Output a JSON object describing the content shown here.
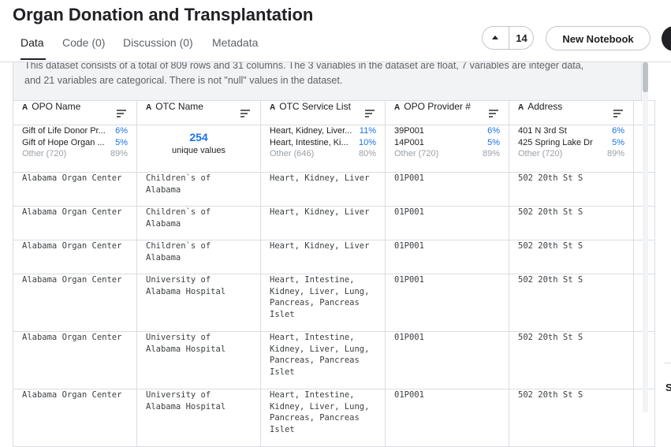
{
  "page": {
    "title": "Organ Donation and Transplantation",
    "tabs": [
      {
        "label": "Data"
      },
      {
        "label": "Code (0)"
      },
      {
        "label": "Discussion (0)"
      },
      {
        "label": "Metadata"
      }
    ],
    "vote_count": "14",
    "new_notebook_label": "New Notebook",
    "side_letter": "S"
  },
  "description": {
    "line1": "This dataset consists of a total of 809 rows and 31 columns. The 3 variables in the dataset are float, 7 variables are integer data,",
    "line2": "and 21 variables are categorical. There is not \"null\" values in the dataset."
  },
  "columns": [
    {
      "type_icon": "A",
      "label": "OPO Name"
    },
    {
      "type_icon": "A",
      "label": "OTC Name"
    },
    {
      "type_icon": "A",
      "label": "OTC Service List"
    },
    {
      "type_icon": "A",
      "label": "OPO Provider #"
    },
    {
      "type_icon": "A",
      "label": "Address"
    }
  ],
  "summary": {
    "opo_name": [
      {
        "k": "Gift of Life Donor Pr...",
        "p": "6%"
      },
      {
        "k": "Gift of Hope Organ ...",
        "p": "5%"
      },
      {
        "k": "Other (720)",
        "p": "89%"
      }
    ],
    "otc_name": {
      "n": "254",
      "l": "unique values"
    },
    "otc_service_list": [
      {
        "k": "Heart, Kidney, Liver...",
        "p": "11%"
      },
      {
        "k": "Heart, Intestine, Ki...",
        "p": "10%"
      },
      {
        "k": "Other (646)",
        "p": "80%"
      }
    ],
    "opo_provider": [
      {
        "k": "39P001",
        "p": "6%"
      },
      {
        "k": "14P001",
        "p": "5%"
      },
      {
        "k": "Other (720)",
        "p": "89%"
      }
    ],
    "address": [
      {
        "k": "401 N 3rd St",
        "p": "6%"
      },
      {
        "k": "425 Spring Lake Dr",
        "p": "5%"
      },
      {
        "k": "Other (720)",
        "p": "89%"
      }
    ]
  },
  "rows": [
    {
      "opo": "Alabama Organ Center",
      "otc": "Children`s of\nAlabama",
      "svc": "Heart, Kidney, Liver",
      "prov": "01P001",
      "addr": "502 20th St S"
    },
    {
      "opo": "Alabama Organ Center",
      "otc": "Children`s of\nAlabama",
      "svc": "Heart, Kidney, Liver",
      "prov": "01P001",
      "addr": "502 20th St S"
    },
    {
      "opo": "Alabama Organ Center",
      "otc": "Children`s of\nAlabama",
      "svc": "Heart, Kidney, Liver",
      "prov": "01P001",
      "addr": "502 20th St S"
    },
    {
      "opo": "Alabama Organ Center",
      "otc": "University of\nAlabama Hospital",
      "svc": "Heart, Intestine,\nKidney, Liver, Lung,\nPancreas, Pancreas\nIslet",
      "prov": "01P001",
      "addr": "502 20th St S"
    },
    {
      "opo": "Alabama Organ Center",
      "otc": "University of\nAlabama Hospital",
      "svc": "Heart, Intestine,\nKidney, Liver, Lung,\nPancreas, Pancreas\nIslet",
      "prov": "01P001",
      "addr": "502 20th St S"
    },
    {
      "opo": "Alabama Organ Center",
      "otc": "University of\nAlabama Hospital",
      "svc": "Heart, Intestine,\nKidney, Liver, Lung,\nPancreas, Pancreas\nIslet",
      "prov": "01P001",
      "addr": "502 20th St S"
    }
  ]
}
